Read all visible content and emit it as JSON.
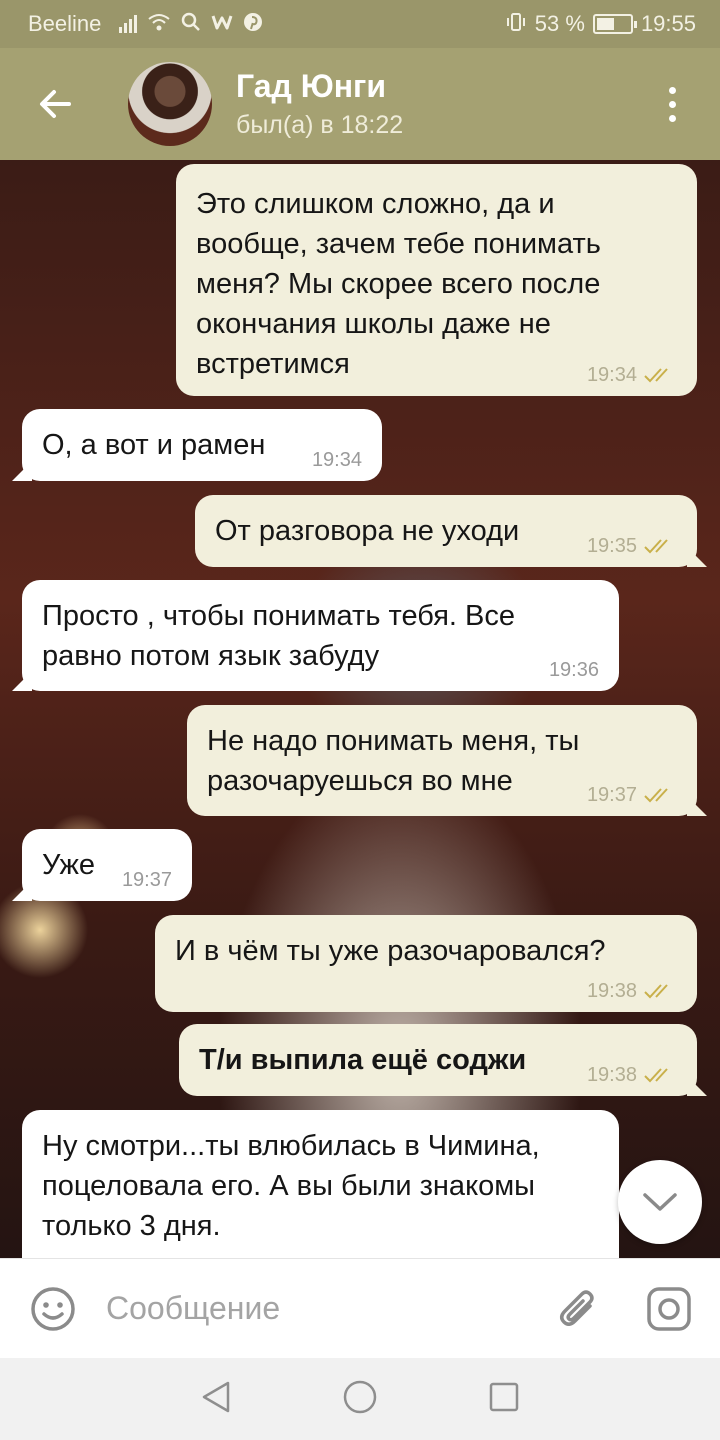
{
  "status_bar": {
    "carrier": "Beeline",
    "battery_percent": "53 %",
    "battery_level": 0.53,
    "time": "19:55"
  },
  "header": {
    "contact_name": "Гад Юнги",
    "last_seen": "был(а) в 18:22"
  },
  "messages": [
    {
      "direction": "out",
      "text": "Это слишком сложно, да и вообще, зачем тебе понимать меня? Мы скорее всего после окончания школы даже не встретимся",
      "time": "19:34",
      "read": true
    },
    {
      "direction": "in",
      "text": "О, а вот и рамен",
      "time": "19:34"
    },
    {
      "direction": "out",
      "text": "От разговора не уходи",
      "time": "19:35",
      "read": true
    },
    {
      "direction": "in",
      "text": "Просто , чтобы понимать тебя. Все равно потом язык забуду",
      "time": "19:36"
    },
    {
      "direction": "out",
      "text": "Не надо понимать меня, ты разочаруешься во мне",
      "time": "19:37",
      "read": true
    },
    {
      "direction": "in",
      "text": "Уже",
      "time": "19:37"
    },
    {
      "direction": "out",
      "text": "И в чём ты уже разочаровался?",
      "time": "19:38",
      "read": true
    },
    {
      "direction": "out",
      "text": "Т/и выпила ещё соджи",
      "time": "19:38",
      "read": true,
      "bold": true
    },
    {
      "direction": "in",
      "text": "Ну смотри...ты влюбилась в Чимина, поцеловала его. А вы были знакомы только 3 дня.",
      "time": ""
    }
  ],
  "composer": {
    "placeholder": "Сообщение"
  },
  "colors": {
    "header_bg": "#a5a172",
    "status_bg": "#9a966a",
    "outgoing_bubble": "#f2efdc",
    "incoming_bubble": "#ffffff",
    "read_check": "#c9b04a"
  },
  "icons": {
    "back": "arrow-left-icon",
    "menu": "more-vertical-icon",
    "scroll": "chevron-down-icon",
    "emoji": "smile-icon",
    "attach": "paperclip-icon",
    "camera": "camera-icon"
  }
}
